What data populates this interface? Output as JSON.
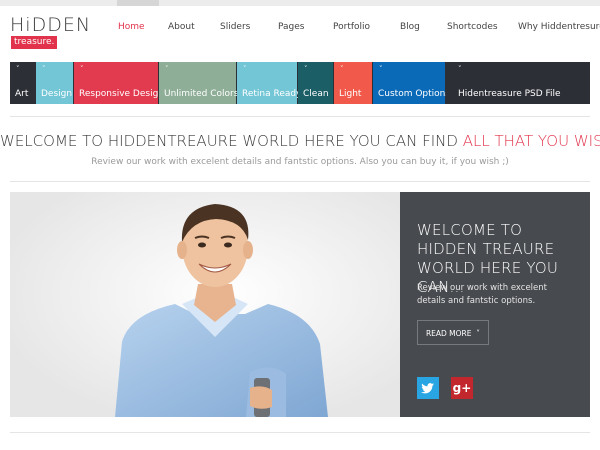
{
  "logo": {
    "main": "HiDDEN",
    "sub": "treasure."
  },
  "nav": {
    "items": [
      {
        "label": "Home",
        "active": true
      },
      {
        "label": "About"
      },
      {
        "label": "Sliders"
      },
      {
        "label": "Pages"
      },
      {
        "label": "Portfolio"
      },
      {
        "label": "Blog"
      },
      {
        "label": "Shortcodes"
      },
      {
        "label": "Why Hiddentresure?"
      }
    ]
  },
  "tiles": [
    {
      "label": "Art",
      "color": "#2d2f37"
    },
    {
      "label": "Design",
      "color": "#73c6d6"
    },
    {
      "label": "Responsive Design",
      "color": "#e23b4f"
    },
    {
      "label": "Unlimited Colors",
      "color": "#8fae97"
    },
    {
      "label": "Retina Ready",
      "color": "#73c6d6"
    },
    {
      "label": "Clean",
      "color": "#1b5e66"
    },
    {
      "label": "Light",
      "color": "#f15a4b"
    },
    {
      "label": "Custom Options",
      "color": "#0b6ab8"
    },
    {
      "label": "Hidentreasure PSD File",
      "color": "#2d2f37"
    }
  ],
  "welcome": {
    "main": "WELCOME TO HIDDENTREAURE WORLD HERE YOU CAN FIND ",
    "accent": "ALL THAT YOU WISH",
    "sub": "Review our work with excelent details and fantstic options. Also you can buy it, if you wish ;)"
  },
  "hero": {
    "title": "WELCOME TO HIDDEN TREAURE WORLD HERE YOU CAN...",
    "text": "Review our work with excelent details and fantstic options.",
    "button": "READ MORE",
    "button_icon": "chevron-down-icon"
  },
  "social": {
    "twitter_icon": "twitter-icon",
    "googleplus_label": "g+"
  },
  "colors": {
    "accent": "#e1334b",
    "panel": "#474a4e"
  }
}
